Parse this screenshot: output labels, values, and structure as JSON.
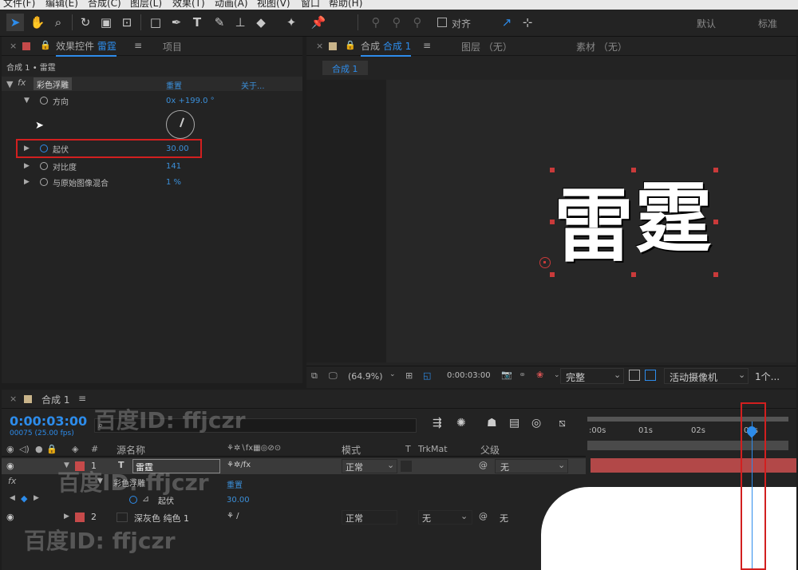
{
  "menubar": {
    "items": [
      "文件(F)",
      "编辑(E)",
      "合成(C)",
      "图层(L)",
      "效果(T)",
      "动画(A)",
      "视图(V)",
      "窗口",
      "帮助(H)"
    ]
  },
  "toolbar": {
    "align_label": "对齐",
    "workspace_default": "默认",
    "workspace_standard": "标准"
  },
  "effects_panel": {
    "tab_label": "效果控件",
    "layer_name": "雷霆",
    "project_tab": "项目",
    "breadcrumb": "合成 1 • 雷霆",
    "effect_name": "彩色浮雕",
    "reset_label": "重置",
    "about_label": "关于...",
    "properties": [
      {
        "name": "方向",
        "value": "0x +199.0 °"
      },
      {
        "name": "起伏",
        "value": "30.00"
      },
      {
        "name": "对比度",
        "value": "141"
      },
      {
        "name": "与原始图像混合",
        "value": "1 %"
      }
    ]
  },
  "composition_viewer": {
    "tab_prefix": "合成",
    "tab_name": "合成 1",
    "layer_tab": "图层 （无）",
    "footage_tab": "素材 （无）",
    "comp_chip": "合成 1",
    "artwork_text": [
      "雷",
      "霆"
    ],
    "zoom": "(64.9%)",
    "timecode": "0:00:03:00",
    "quality": "完整",
    "camera": "活动摄像机",
    "views": "1个..."
  },
  "timeline": {
    "tab_label": "合成 1",
    "current_time": "0:00:03:00",
    "frame_info": "00075 (25.00 fps)",
    "search_placeholder": "",
    "columns": {
      "hash": "#",
      "source_name": "源名称",
      "mode": "模式",
      "t": "T",
      "trkmat": "TrkMat",
      "parent": "父级"
    },
    "ruler": [
      ":00s",
      "01s",
      "02s",
      "03s"
    ],
    "layers": [
      {
        "num": "1",
        "name": "雷霆",
        "mode": "正常",
        "parent": "无",
        "color": "#c64a4a"
      },
      {
        "num": "2",
        "name": "深灰色 纯色 1",
        "mode": "正常",
        "trkmat": "无",
        "parent": "无",
        "color": "#c64a4a"
      }
    ],
    "effect_row": {
      "name": "彩色浮雕",
      "reset": "重置"
    },
    "property_row": {
      "name": "起伏",
      "value": "30.00"
    }
  },
  "watermark": {
    "text": "百度ID: ffjczr"
  },
  "colors": {
    "accent": "#2d8ceb",
    "highlight_box": "#d21f1f",
    "layer_label": "#c64a4a"
  }
}
